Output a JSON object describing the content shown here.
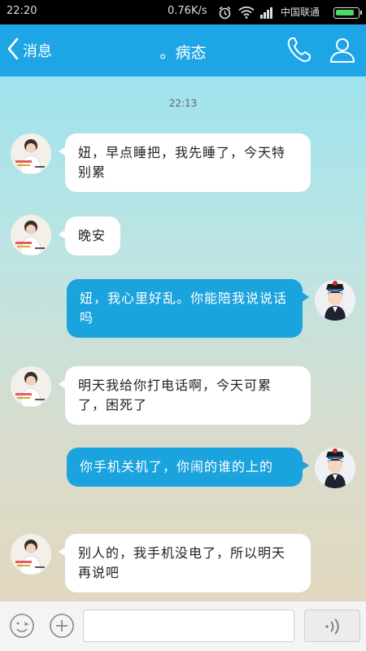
{
  "status_bar": {
    "time": "22:20",
    "net_speed": "0.76K/s",
    "carrier": "中国联通",
    "battery_color": "#4cd964",
    "icons": [
      "alarm-icon",
      "wifi-icon",
      "signal-icon",
      "battery-icon"
    ]
  },
  "header": {
    "back_label": "消息",
    "title": "。病态",
    "icons": [
      "back-chevron-icon",
      "phone-icon",
      "profile-icon"
    ],
    "accent": "#1ea5e6"
  },
  "chat": {
    "timestamp": "22:13",
    "messages": [
      {
        "side": "in",
        "text": "妞，早点睡把，我先睡了，今天特别累"
      },
      {
        "side": "in",
        "text": "晚安"
      },
      {
        "side": "out",
        "text": "妞，我心里好乱。你能陪我说说话吗"
      },
      {
        "side": "in",
        "text": "明天我给你打电话啊，今天可累了，困死了"
      },
      {
        "side": "out",
        "text": "你手机关机了，你闹的谁的上的"
      },
      {
        "side": "in",
        "text": "别人的，我手机没电了，所以明天再说吧"
      }
    ]
  },
  "input_bar": {
    "text_value": "",
    "icons": [
      "emoji-icon",
      "add-icon",
      "voice-icon"
    ]
  }
}
